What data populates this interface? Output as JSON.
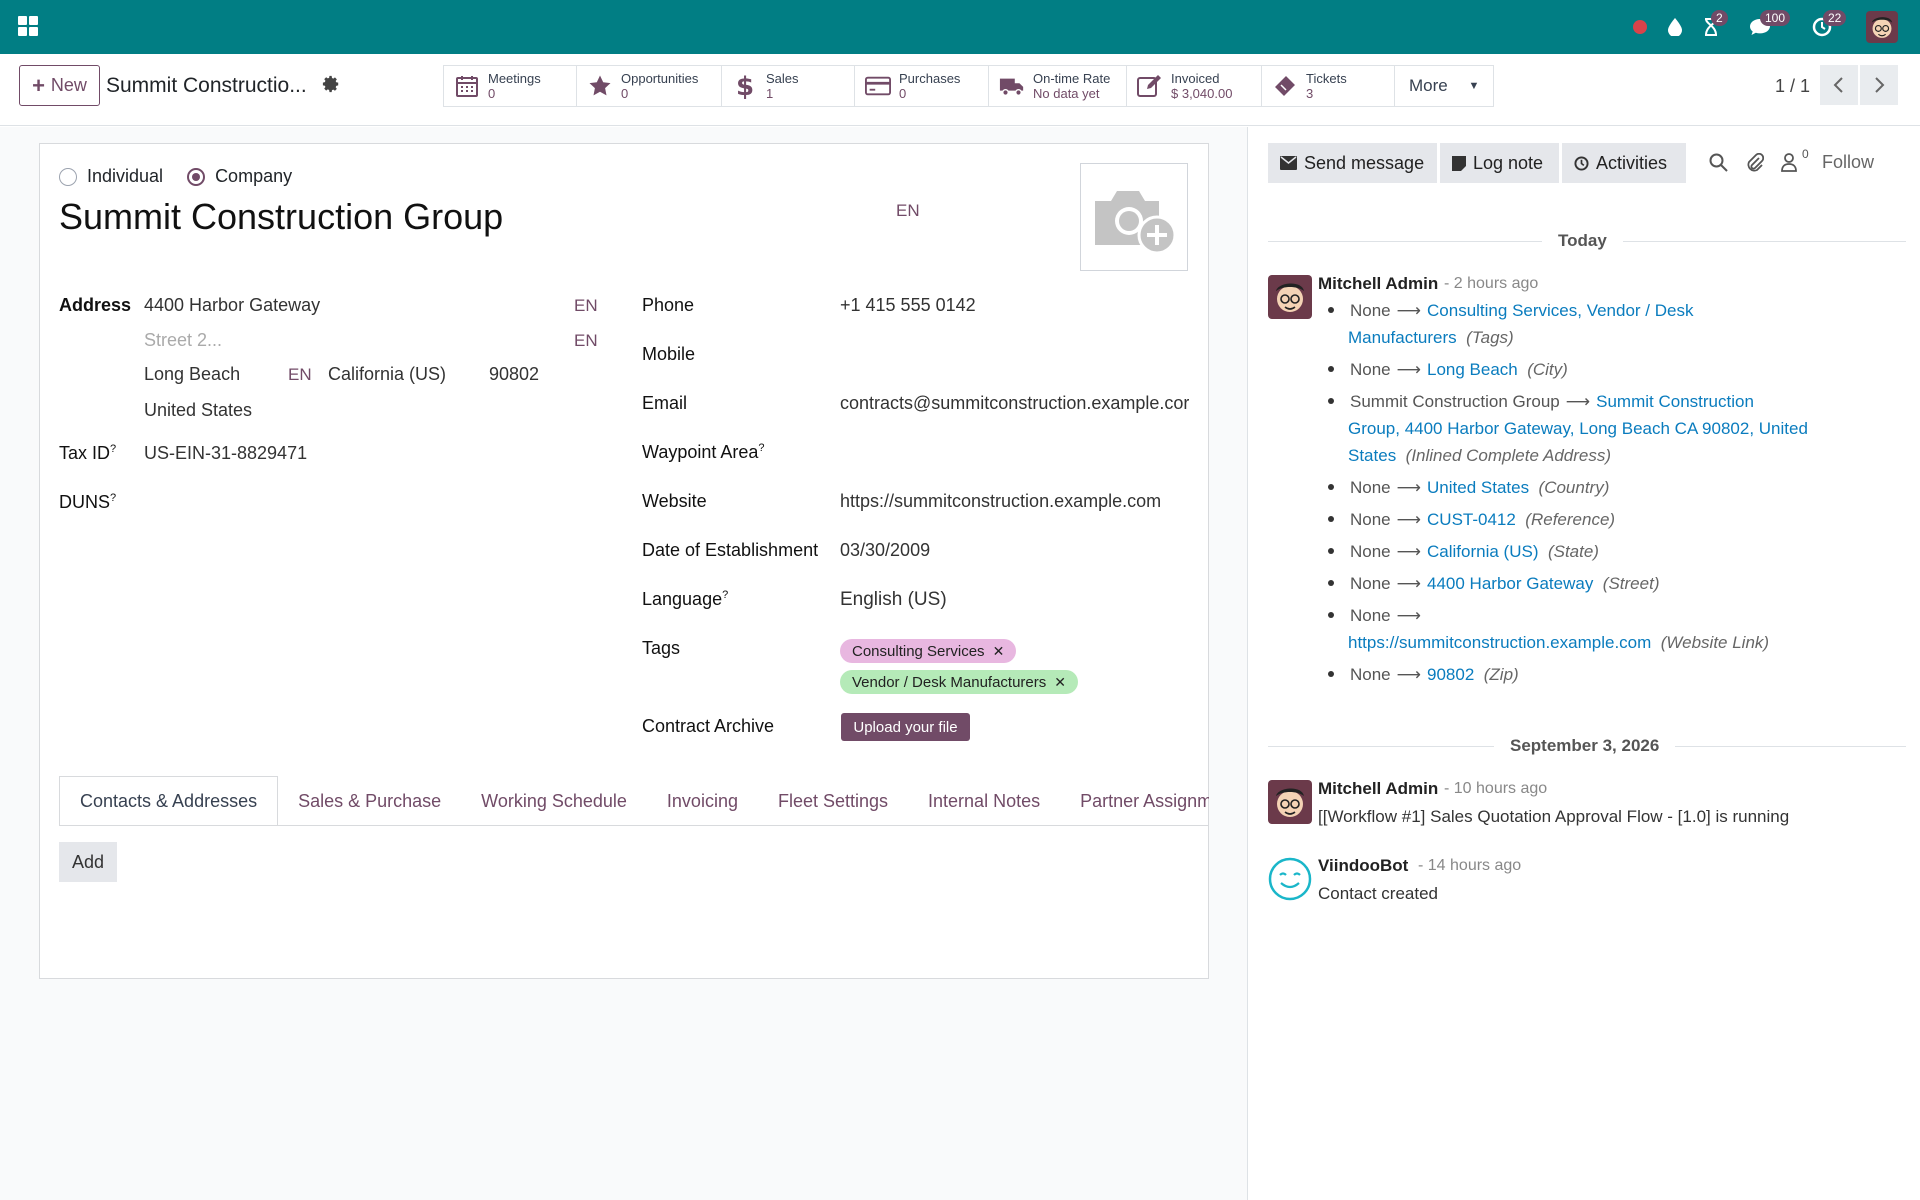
{
  "topbar": {
    "message_count": "100",
    "activity_count": "2",
    "clock_count": "22",
    "accent": "#017e84"
  },
  "control_panel": {
    "new_label": "New",
    "record_title": "Summit Constructio...",
    "smart_buttons": [
      {
        "label": "Meetings",
        "value": "0",
        "icon": "calendar-icon"
      },
      {
        "label": "Opportunities",
        "value": "0",
        "icon": "star-icon"
      },
      {
        "label": "Sales",
        "value": "1",
        "icon": "dollar-icon"
      },
      {
        "label": "Purchases",
        "value": "0",
        "icon": "credit-card-icon"
      },
      {
        "label": "On-time Rate",
        "value": "No data yet",
        "icon": "truck-icon"
      },
      {
        "label": "Invoiced",
        "value": "$ 3,040.00",
        "icon": "edit-icon"
      },
      {
        "label": "Tickets",
        "value": "3",
        "icon": "ticket-icon"
      }
    ],
    "more_label": "More",
    "pager": "1 / 1"
  },
  "form": {
    "type_individual": "Individual",
    "type_company": "Company",
    "name": "Summit Construction Group",
    "lang_code": "EN",
    "address_label": "Address",
    "street": "4400 Harbor Gateway",
    "street2_placeholder": "Street 2...",
    "city": "Long Beach",
    "state": "California (US)",
    "zip": "90802",
    "country": "United States",
    "tax_id_label": "Tax ID",
    "tax_id": "US-EIN-31-8829471",
    "duns_label": "DUNS",
    "help_mark": "?",
    "phone_label": "Phone",
    "phone": "+1 415 555 0142",
    "mobile_label": "Mobile",
    "email_label": "Email",
    "email": "contracts@summitconstruction.example.cor",
    "waypoint_label": "Waypoint Area",
    "website_label": "Website",
    "website": "https://summitconstruction.example.com",
    "doe_label": "Date of Establishment",
    "doe": "03/30/2009",
    "language_label": "Language",
    "language": "English (US)",
    "tags_label": "Tags",
    "tags": [
      {
        "label": "Consulting Services",
        "color": "#e8b7e0"
      },
      {
        "label": "Vendor / Desk Manufacturers",
        "color": "#b5eab8"
      }
    ],
    "contract_label": "Contract Archive",
    "upload_label": "Upload your file",
    "tabs": [
      "Contacts & Addresses",
      "Sales & Purchase",
      "Working Schedule",
      "Invoicing",
      "Fleet Settings",
      "Internal Notes",
      "Partner Assignm"
    ],
    "add_label": "Add"
  },
  "chatter": {
    "send_message": "Send message",
    "log_note": "Log note",
    "activities": "Activities",
    "follower_count": "0",
    "follow": "Follow",
    "today": "Today",
    "msg1": {
      "author": "Mitchell Admin",
      "time": "- 2 hours ago",
      "changes": [
        {
          "old": "None",
          "new_l1": "Consulting Services, Vendor / Desk",
          "new_l2": "Manufacturers",
          "field": "(Tags)"
        },
        {
          "old": "None",
          "new": "Long Beach",
          "field": "(City)"
        },
        {
          "old": "Summit Construction Group",
          "new_l1": "Summit Construction",
          "new_l2": "Group, 4400 Harbor Gateway, Long Beach CA 90802, United",
          "new_l3": "States",
          "field": "(Inlined Complete Address)"
        },
        {
          "old": "None",
          "new": "United States",
          "field": "(Country)"
        },
        {
          "old": "None",
          "new": "CUST-0412",
          "field": "(Reference)"
        },
        {
          "old": "None",
          "new": "California (US)",
          "field": "(State)"
        },
        {
          "old": "None",
          "new": "4400 Harbor Gateway",
          "field": "(Street)"
        },
        {
          "old": "None",
          "new": "https://summitconstruction.example.com",
          "field": "(Website Link)"
        },
        {
          "old": "None",
          "new": "90802",
          "field": "(Zip)"
        }
      ]
    },
    "date_sep": "September 3, 2026",
    "msg2": {
      "author": "Mitchell Admin",
      "time": "- 10 hours ago",
      "body": "[[Workflow #1] Sales Quotation Approval Flow - [1.0] is running"
    },
    "msg3": {
      "author": "ViindooBot",
      "time": "- 14 hours ago",
      "body": "Contact created"
    }
  }
}
